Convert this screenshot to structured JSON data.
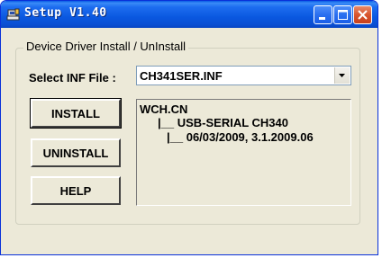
{
  "window": {
    "title": "Setup V1.40"
  },
  "group": {
    "legend": "Device Driver Install / UnInstall"
  },
  "inf": {
    "label": "Select INF File :",
    "selected": "CH341SER.INF"
  },
  "buttons": {
    "install": "INSTALL",
    "uninstall": "UNINSTALL",
    "help": "HELP"
  },
  "driver_info": {
    "lines": [
      "WCH.CN",
      "|__ USB-SERIAL CH340",
      "|__ 06/03/2009, 3.1.2009.06"
    ]
  },
  "colors": {
    "titlebar": "#0a58e0",
    "close_button": "#d8552e",
    "face": "#ece9d8"
  },
  "icons": [
    "setup-app-icon",
    "minimize-icon",
    "maximize-icon",
    "close-icon",
    "dropdown-arrow-icon"
  ]
}
